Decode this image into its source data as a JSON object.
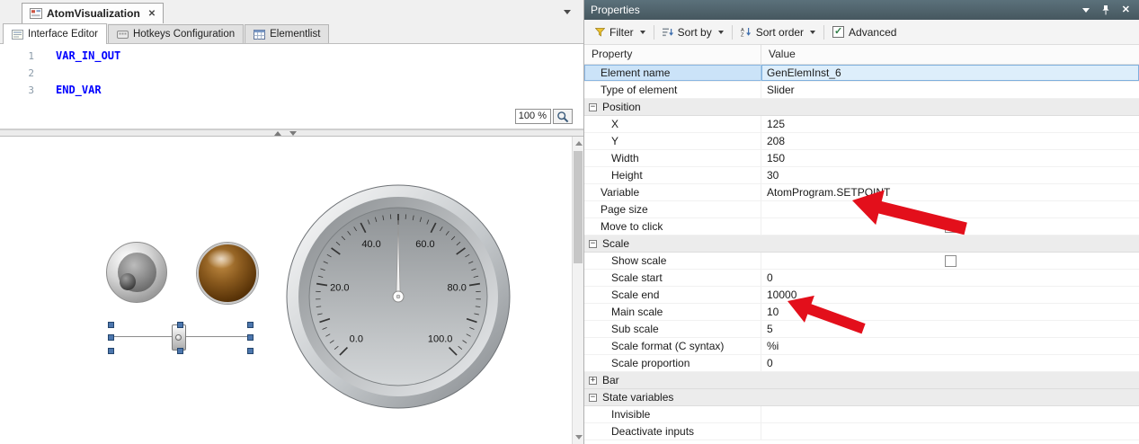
{
  "icons": {
    "close": "✕",
    "check": "✓",
    "collapse": "−",
    "expand": "+"
  },
  "left": {
    "doc_tab": {
      "title": "AtomVisualization"
    },
    "sub_tabs": [
      {
        "label": "Interface Editor",
        "active": true
      },
      {
        "label": "Hotkeys Configuration",
        "active": false
      },
      {
        "label": "Elementlist",
        "active": false
      }
    ],
    "editor": {
      "lines": [
        {
          "num": "1",
          "text": "VAR_IN_OUT"
        },
        {
          "num": "2",
          "text": ""
        },
        {
          "num": "3",
          "text": "END_VAR"
        }
      ],
      "zoom_value": "100 %"
    },
    "canvas": {
      "gauge": {
        "min": 0,
        "max": 100,
        "needle_value": 50,
        "label_values": [
          0,
          20,
          40,
          60,
          80,
          100
        ],
        "labels": [
          "0.0",
          "20.0",
          "40.0",
          "60.0",
          "80.0",
          "100.0"
        ]
      }
    }
  },
  "properties": {
    "title": "Properties",
    "toolbar": {
      "filter_label": "Filter",
      "sort_by_label": "Sort by",
      "sort_order_label": "Sort order",
      "advanced_label": "Advanced",
      "advanced_checked": true
    },
    "columns": {
      "property": "Property",
      "value": "Value"
    },
    "rows": [
      {
        "kind": "prop",
        "label": "Element name",
        "value": "GenElemInst_6",
        "indent": 1,
        "selected": true
      },
      {
        "kind": "prop",
        "label": "Type of element",
        "value": "Slider",
        "indent": 1
      },
      {
        "kind": "group",
        "label": "Position",
        "expanded": true
      },
      {
        "kind": "prop",
        "label": "X",
        "value": "125",
        "indent": 2
      },
      {
        "kind": "prop",
        "label": "Y",
        "value": "208",
        "indent": 2
      },
      {
        "kind": "prop",
        "label": "Width",
        "value": "150",
        "indent": 2
      },
      {
        "kind": "prop",
        "label": "Height",
        "value": "30",
        "indent": 2
      },
      {
        "kind": "prop",
        "label": "Variable",
        "value": "AtomProgram.SETPOINT",
        "indent": 1
      },
      {
        "kind": "prop",
        "label": "Page size",
        "value": "",
        "indent": 1
      },
      {
        "kind": "checkbox",
        "label": "Move to click",
        "checked": false,
        "indent": 1
      },
      {
        "kind": "group",
        "label": "Scale",
        "expanded": true
      },
      {
        "kind": "checkbox",
        "label": "Show scale",
        "checked": false,
        "indent": 2
      },
      {
        "kind": "prop",
        "label": "Scale start",
        "value": "0",
        "indent": 2
      },
      {
        "kind": "prop",
        "label": "Scale end",
        "value": "10000",
        "indent": 2
      },
      {
        "kind": "prop",
        "label": "Main scale",
        "value": "10",
        "indent": 2
      },
      {
        "kind": "prop",
        "label": "Sub scale",
        "value": "5",
        "indent": 2
      },
      {
        "kind": "prop",
        "label": "Scale format (C syntax)",
        "value": "%i",
        "indent": 2
      },
      {
        "kind": "prop",
        "label": "Scale proportion",
        "value": "0",
        "indent": 2
      },
      {
        "kind": "group",
        "label": "Bar",
        "expanded": false
      },
      {
        "kind": "group",
        "label": "State variables",
        "expanded": true
      },
      {
        "kind": "prop",
        "label": "Invisible",
        "value": "",
        "indent": 2
      },
      {
        "kind": "prop",
        "label": "Deactivate inputs",
        "value": "",
        "indent": 2
      }
    ]
  },
  "colors": {
    "selection_blue": "#cbe3f8",
    "panel_title_bg": "#4c5f68",
    "annotation_arrow_red": "#e30f1b",
    "keyword_blue": "#0000ff"
  }
}
